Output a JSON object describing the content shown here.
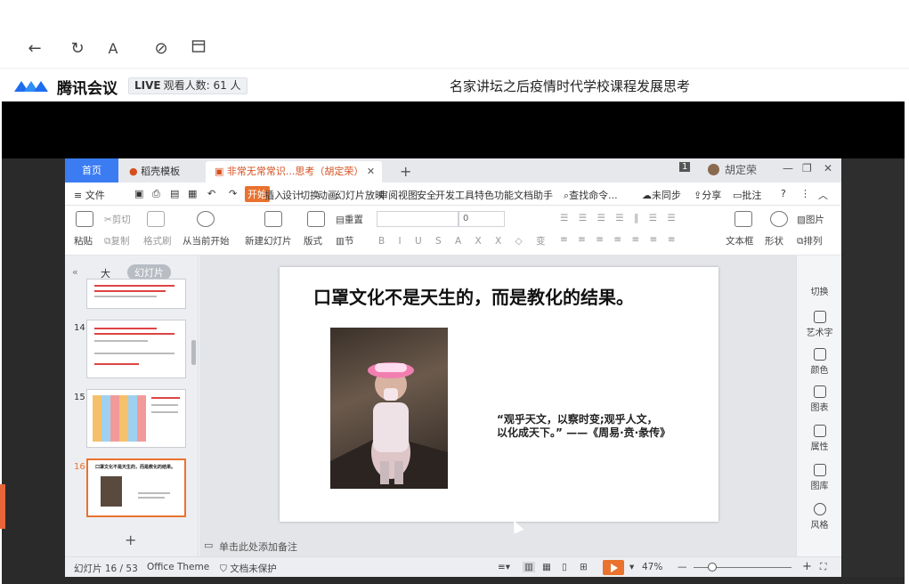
{
  "meeting": {
    "brand": "腾讯会议",
    "live_label": "LIVE",
    "viewers": "观看人数: 61 人",
    "title": "名家讲坛之后疫情时代学校课程发展思考"
  },
  "wps": {
    "tabs": {
      "home": "首页",
      "template": "稻壳模板",
      "document": "非常无常常识...思考（胡定荣）",
      "plus": "+"
    },
    "user": "胡定荣",
    "badge": "1",
    "menu": {
      "file": "≡ 文件",
      "start": "开始",
      "insert": "插入",
      "design": "设计",
      "transition": "切换",
      "animation": "动画",
      "slideshow": "幻灯片放映",
      "review": "审阅",
      "view": "视图",
      "security": "安全",
      "dev": "开发工具",
      "special": "特色功能",
      "doc_helper": "文档助手",
      "search": "查找命令...",
      "sync": "未同步",
      "share": "分享",
      "comment": "批注"
    },
    "ribbon": {
      "paste": "粘贴",
      "cut": "剪切",
      "copy": "复制",
      "format_painter": "格式刷",
      "from_current": "从当前开始",
      "new_slide": "新建幻灯片",
      "layout": "版式",
      "section": "节",
      "reset": "重置",
      "font_size": "0",
      "textbox": "文本框",
      "shape": "形状",
      "picture": "图片",
      "arrange": "排列"
    },
    "panel": {
      "outline": "大纲",
      "slides": "幻灯片",
      "thumbs": [
        "14",
        "15",
        "16"
      ],
      "active_title": "口罩文化不是天生的，而是教化的结果。",
      "add": "+"
    },
    "slide": {
      "title": "口罩文化不是天生的，而是教化的结果。",
      "quote": "“观乎天文，以察时变;观乎人文，以化成天下。” ——《周易·贲·彖传》"
    },
    "notes": "单击此处添加备注",
    "sidebar": [
      "切换",
      "艺术字",
      "颜色",
      "图表",
      "属性",
      "图库",
      "风格"
    ],
    "status": {
      "slide_count": "幻灯片 16 / 53",
      "theme": "Office Theme",
      "protect": "文档未保护",
      "zoom": "47%"
    }
  }
}
